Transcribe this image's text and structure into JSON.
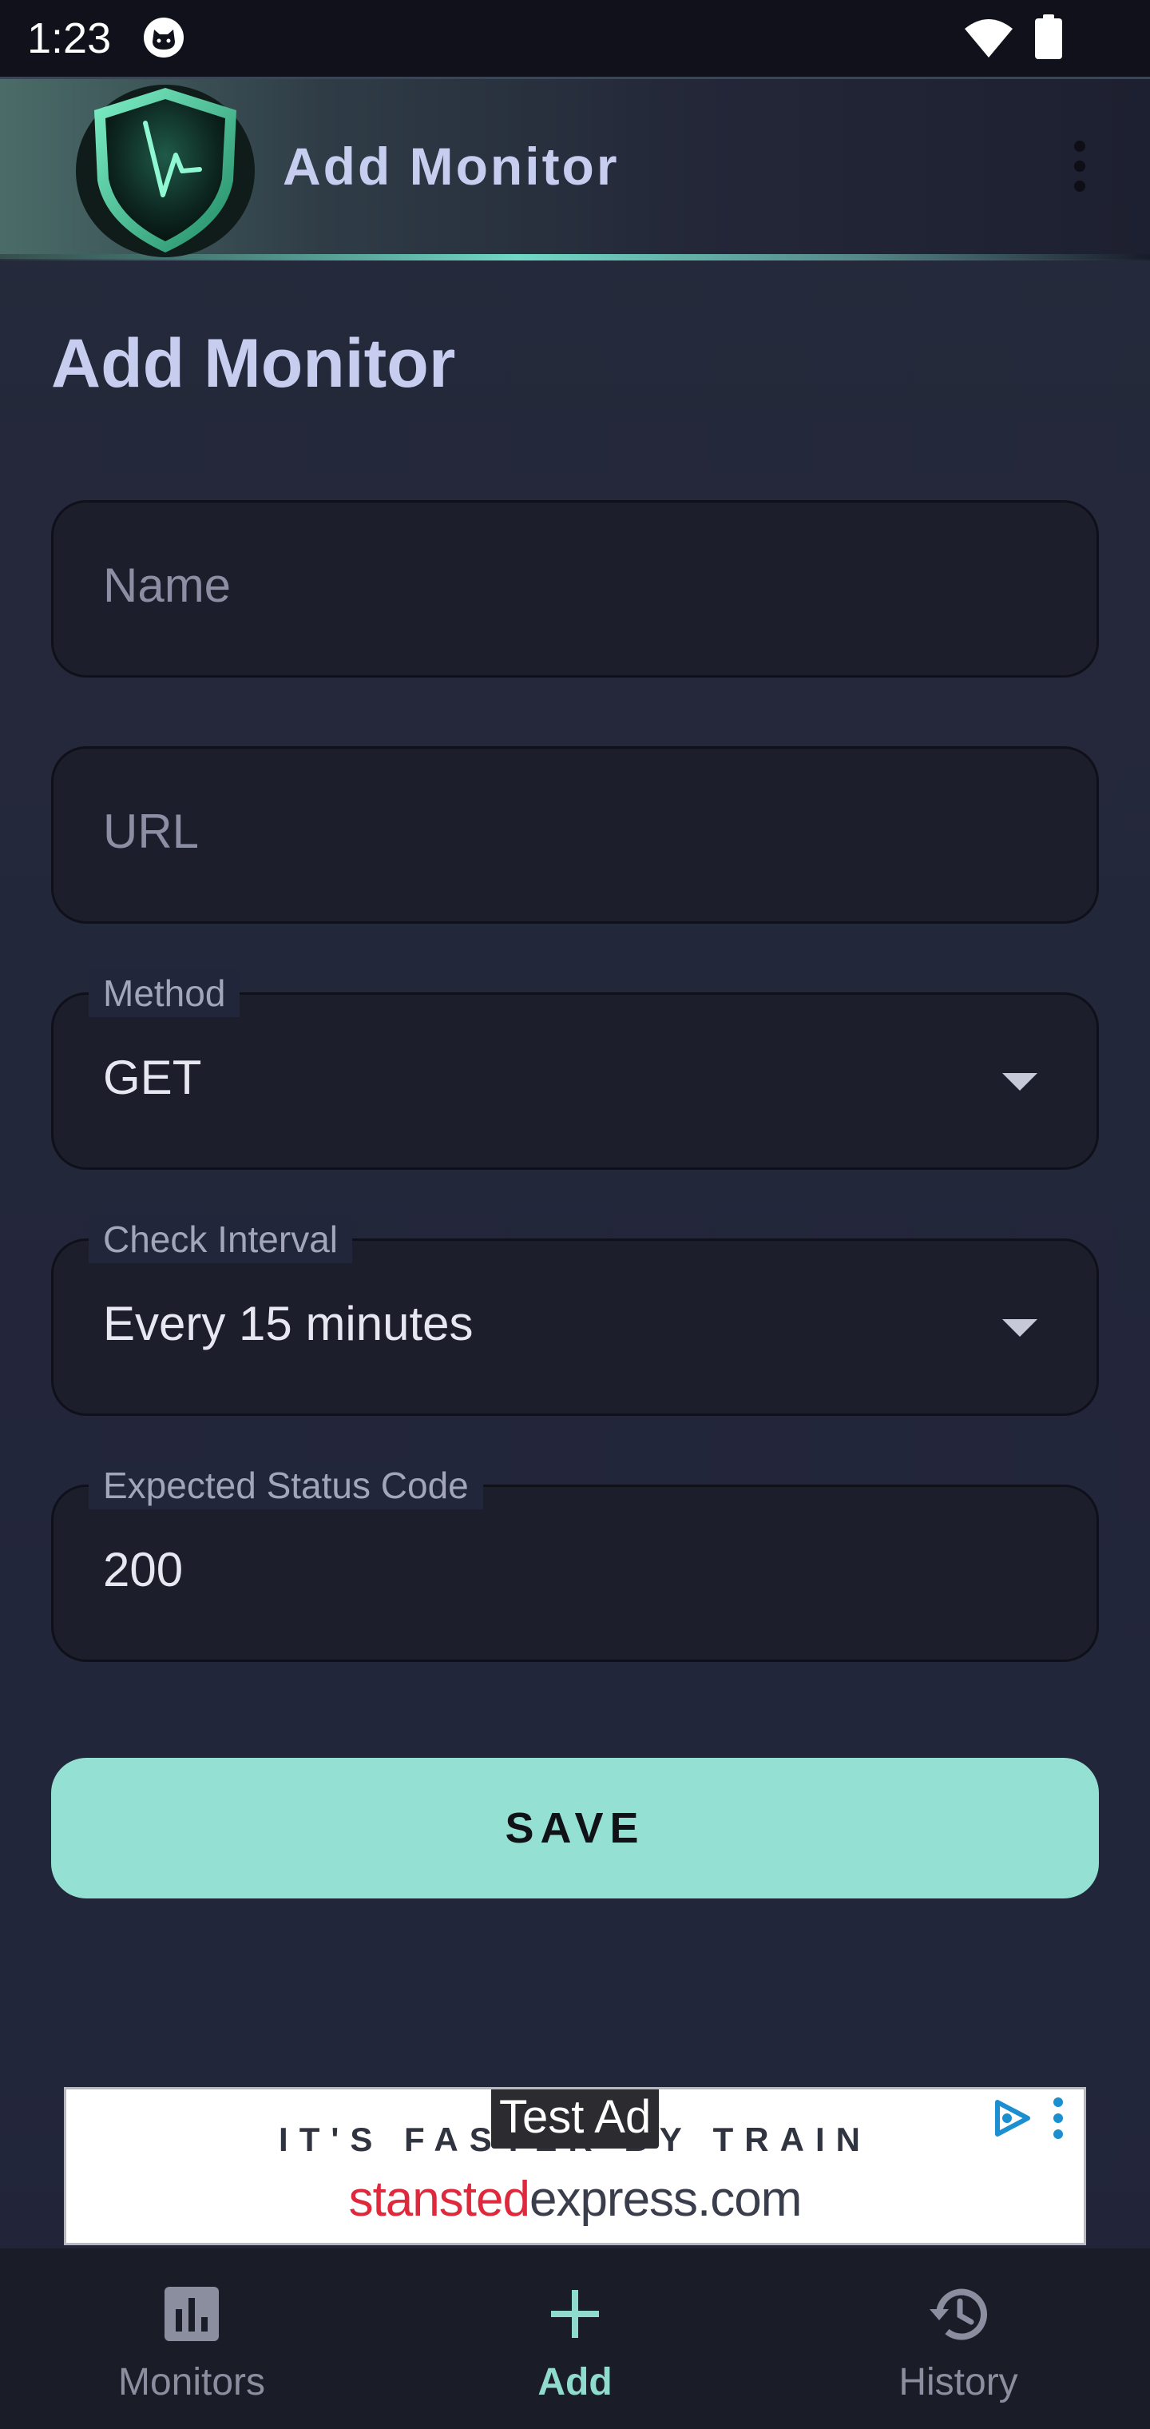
{
  "status_bar": {
    "time": "1:23",
    "icons": [
      "cat-notification-icon",
      "wifi-icon",
      "battery-icon"
    ]
  },
  "app_bar": {
    "title": "Add Monitor",
    "logo_icon": "shield-heartbeat-logo",
    "menu_icon": "more-vert-icon"
  },
  "page": {
    "heading": "Add Monitor"
  },
  "form": {
    "name": {
      "placeholder": "Name",
      "value": ""
    },
    "url": {
      "placeholder": "URL",
      "value": ""
    },
    "method": {
      "label": "Method",
      "value": "GET"
    },
    "interval": {
      "label": "Check Interval",
      "value": "Every 15 minutes"
    },
    "status_code": {
      "label": "Expected Status Code",
      "value": "200"
    },
    "save_label": "SAVE"
  },
  "ad": {
    "test_label": "Test Ad",
    "tagline": "IT'S FASTER BY TRAIN",
    "domain_part1": "stansted",
    "domain_part2": "express.com"
  },
  "bottom_nav": {
    "items": [
      {
        "label": "Monitors",
        "icon": "bar-chart-icon",
        "active": false
      },
      {
        "label": "Add",
        "icon": "add-icon",
        "active": true
      },
      {
        "label": "History",
        "icon": "history-icon",
        "active": false
      }
    ]
  },
  "colors": {
    "accent": "#94e0d3",
    "active_nav": "#8fdbcd",
    "title_text": "#c6cdef",
    "background": "#22263a"
  }
}
